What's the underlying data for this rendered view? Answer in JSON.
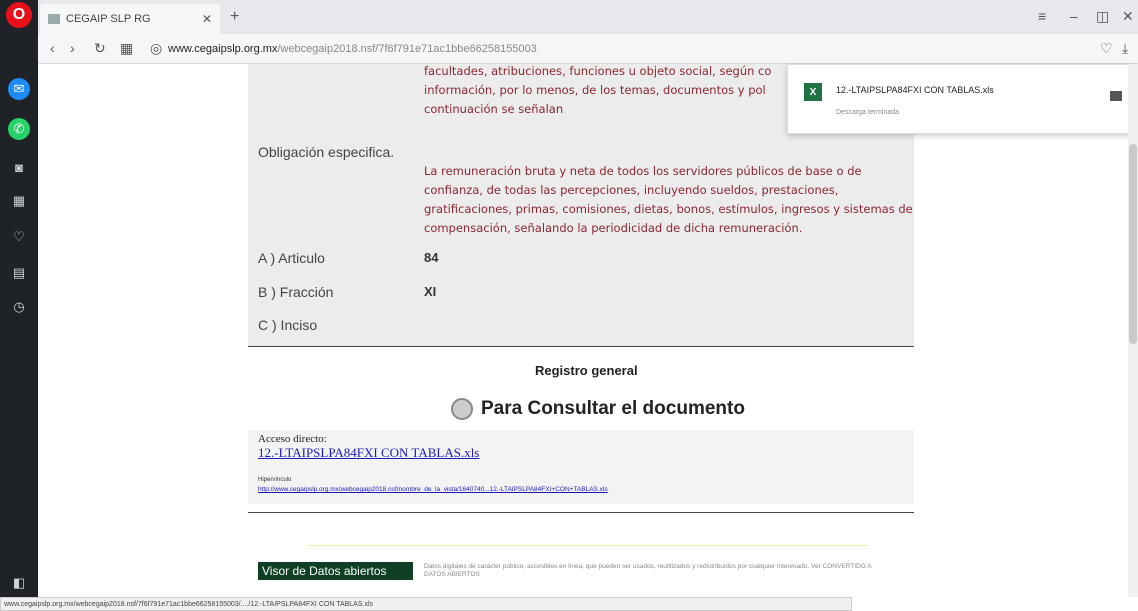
{
  "browser": {
    "tab_title": "CEGAIP SLP RG",
    "url_host": "www.cegaipslp.org.mx",
    "url_rest": "/webcegaip2018.nsf/7f6f791e71ac1bbe66258155003",
    "status_url": "www.cegaipslp.org.mx/webcegaip2018.nsf/7f6f791e71ac1bbe66258155003/..../12.-LTAIPSLPA84FXI CON TABLAS.xls"
  },
  "content": {
    "top_red_partial": "facultades, atribuciones, funciones u objeto social, según co",
    "top_red_line2": "información, por lo menos, de los temas, documentos y pol",
    "top_red_line3": "continuación se señalan",
    "obligacion_label": "Obligación especifica.",
    "obligacion_text": "La remuneración bruta y neta de todos los servidores públicos de base o de confianza, de todas las percepciones, incluyendo sueldos, prestaciones, gratificaciones, primas, comisiones, dietas, bonos, estímulos, ingresos y sistemas de compensación, señalando la periodicidad de dicha remuneración.",
    "articulo_label": "A ) Articulo",
    "articulo_value": "84",
    "fraccion_label": "B ) Fracción",
    "fraccion_value": "XI",
    "inciso_label": "C ) Inciso",
    "registro_label": "Registro general",
    "consultar_label": "Para Consultar el documento",
    "acceso_label": "Acceso directo:",
    "acceso_link": "12.-LTAIPSLPA84FXI CON TABLAS.xls",
    "hipervinculo_label": "Hipervínculo",
    "hipervinculo_link": "http://www.cegaipslp.org.mx/webcegaip2018.nsf/nombre_de_la_vista/1640740...12.-LTAIPSLPA84FXI+CON+TABLAS.xls",
    "visor_label": "Visor de Datos abiertos",
    "visor_desc": "Datos digitales de carácter público, accesibles en línea, que pueden ser usados, reutilizados y redistribuidos por cualquier interesado. Ver CONVERTIDO A DATOS ABIERTOS"
  },
  "download": {
    "file_name": "12.-LTAIPSLPA84FXI CON TABLAS.xls",
    "status": "Descarga terminada"
  },
  "colors": {
    "accent_red": "#8b2631",
    "visor_green": "#0f3f24"
  }
}
